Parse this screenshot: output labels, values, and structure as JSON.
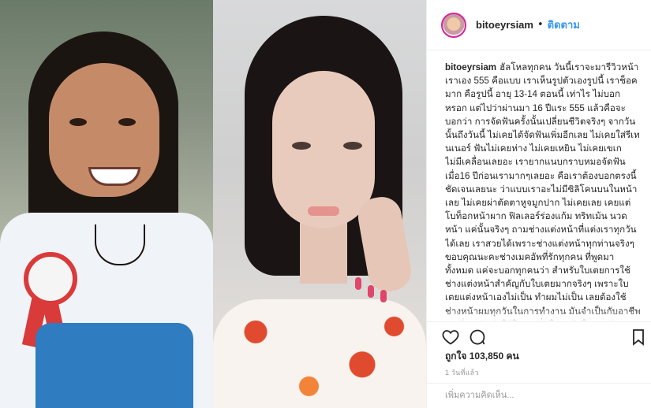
{
  "post": {
    "username": "bitoeyrsiam",
    "separator": "•",
    "follow_label": "ติดตาม",
    "caption_user": "bitoeyrsiam",
    "caption_text": "ฮัลโหลทุกคน วันนี้เราจะมารีวิวหน้าเราเอง 555 คือแบบ เราเห็นรูปตัวเองรูปนี้ เราช็อคมาก คือรูปนี้ อายุ 13-14 ตอนนี้ เท่าไร ไม่บอกหรอก แต่ไปว่าผ่านมา 16 ปีแระ 555 แล้วคือจะบอกว่า การจัดฟันครั้งนั้นเปลี่ยนชีวิตจริงๆ จากวันนั้นถึงวันนี้ ไม่เคยได้จัดฟันเพิ่มอีกเลย ไม่เคยใส่รีเทนเนอร์ ฟันไม่เคยห่าง ไม่เคยเหยิน ไม่เคยเขเก ไม่มีเคลื่อนเลยอะ เรายากแนบกราบหมอจัดฟันเมื่อ16 ปีก่อนเรามากๆเลยอะ คือเราต้องบอกตรงนี้ชัดเจนเลยนะ ว่าแบบเราอะไม่มีซิลิโคนบนในหน้าเลย ไม่เคยผ่าตัดตาหูจมูกปาก ไม่เคยเลย เคยแต่โบท็อกหน้าผาก ฟิลเลอร์ร่องแก้ม ทริทเม้น นวดหน้า แค่นั้นจริงๆ ถามช่างแต่งหน้าที่แต่งเราทุกวันได้เลย เราสวยได้เพราะช่างแต่งหน้าทุกท่านจริงๆ ขอบคุณนะคะช่างเมคอัพที่รักทุกคน ที่พูดมาทั้งหมด แค่จะบอกทุกคนว่า สำหรับใบเตยการใช้ช่างแต่งหน้าสำคัญกับใบเตยมากจริงๆ เพราะใบเตยแต่งหน้าเองไม่เป็น ทำผมไม่เป็น เลยต้องใช้ช่างหน้าผมทุกวันในการทำงาน มันจำเป็นกับอาชีพเราที่สุด มันทำให้ใบเตยมั่นใจทุกวันในการทำงาน ช่างหน้าผม",
    "likes_label": "ถูกใจ 103,850 คน",
    "time_ago": "1 วันที่แล้ว",
    "comment_placeholder": "เพิ่มความคิดเห็น..."
  },
  "icons": {
    "like": "heart-icon",
    "comment": "comment-icon",
    "save": "bookmark-icon"
  },
  "colors": {
    "link_blue": "#3897f0",
    "text": "#262626",
    "muted": "#999999",
    "border": "#efefef"
  }
}
